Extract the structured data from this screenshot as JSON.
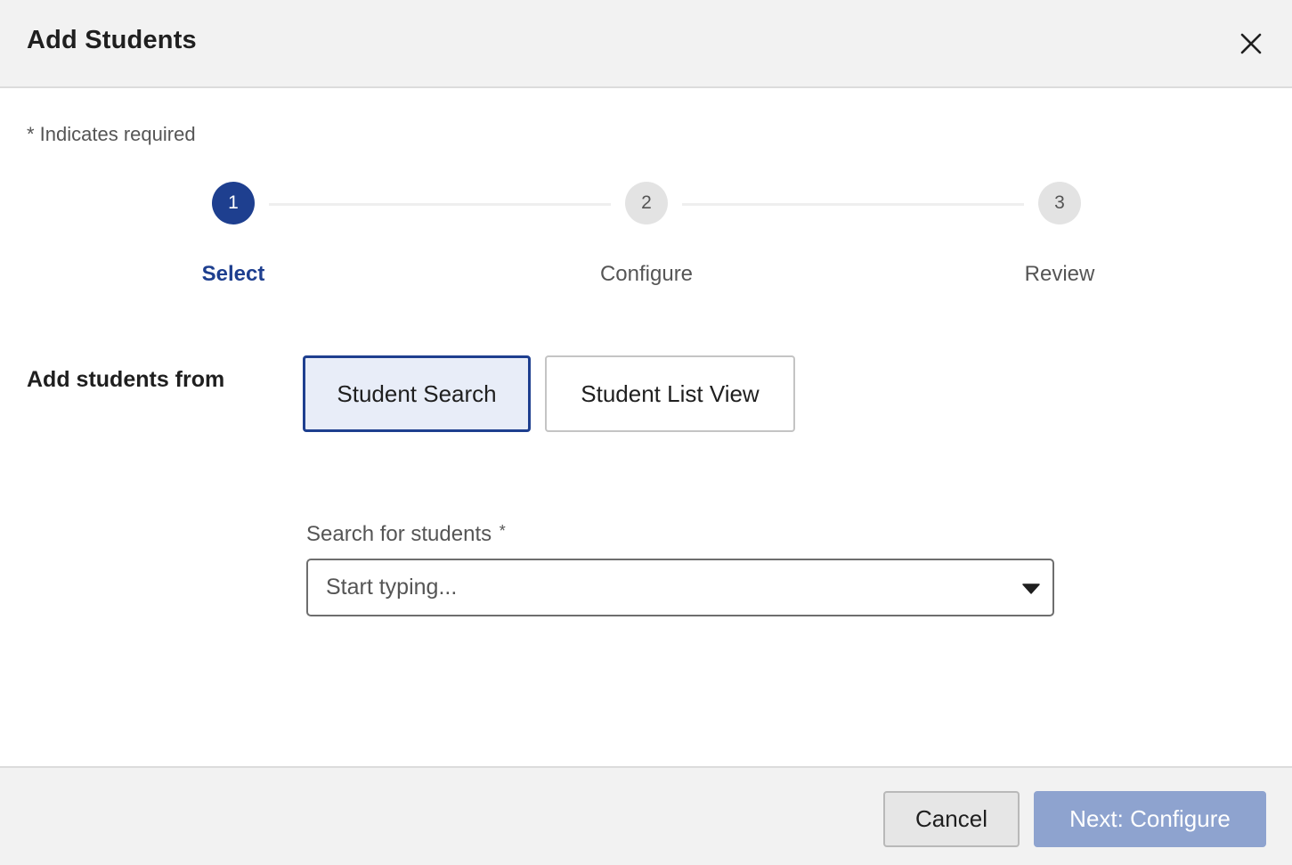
{
  "dialog": {
    "title": "Add Students",
    "close_icon": "close-icon"
  },
  "form": {
    "required_note": "* Indicates required"
  },
  "stepper": {
    "steps": [
      {
        "number": "1",
        "label": "Select",
        "state": "active"
      },
      {
        "number": "2",
        "label": "Configure",
        "state": "inactive"
      },
      {
        "number": "3",
        "label": "Review",
        "state": "inactive"
      }
    ]
  },
  "source": {
    "label": "Add students from",
    "options": [
      {
        "label": "Student Search",
        "selected": true
      },
      {
        "label": "Student List View",
        "selected": false
      }
    ]
  },
  "search": {
    "label": "Search for students",
    "required_marker": "*",
    "placeholder": "Start typing...",
    "value": "",
    "dropdown_icon": "caret-down-icon"
  },
  "footer": {
    "cancel_label": "Cancel",
    "next_label": "Next: Configure"
  },
  "colors": {
    "accent": "#1e3f8f",
    "selected_bg": "#e8edf8",
    "next_disabled": "#8ea3cf",
    "header_bg": "#f2f2f2"
  }
}
